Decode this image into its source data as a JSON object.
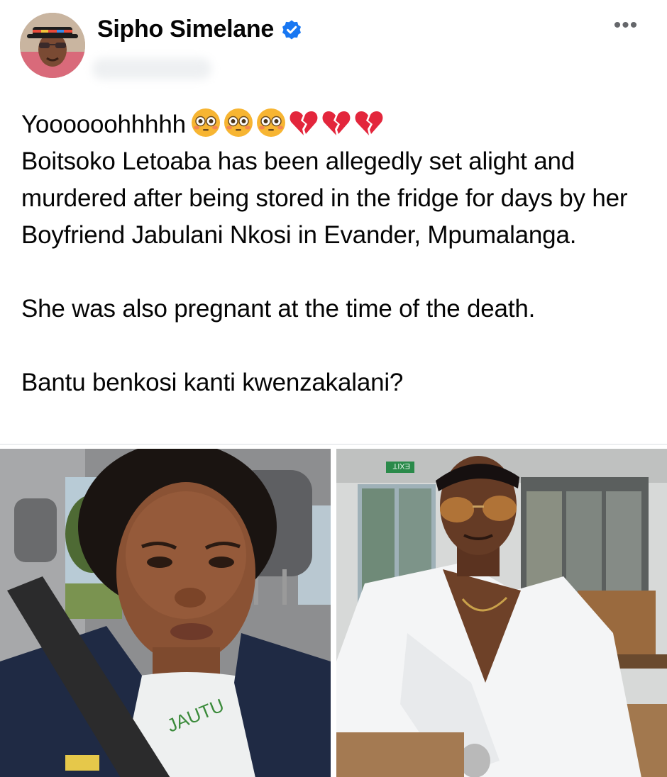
{
  "post": {
    "author": {
      "name": "Sipho Simelane",
      "verified": true,
      "avatar_icon": "profile-photo",
      "verified_icon": "verified-badge-icon"
    },
    "more_icon": "more-horizontal-icon",
    "more_label": "•••",
    "text": {
      "line1": "Yoooooohhhhh",
      "line1_emojis": [
        "flushed-face",
        "flushed-face",
        "flushed-face",
        "broken-heart",
        "broken-heart",
        "broken-heart"
      ],
      "paragraph1": "Boitsoko Letoaba has been allegedly set alight and murdered after being stored in the fridge for days by her Boyfriend Jabulani Nkosi in Evander, Mpumalanga.",
      "paragraph2": "She was also pregnant at the time of the death.",
      "paragraph3": "Bantu benkosi kanti kwenzakalani?"
    },
    "photos": [
      {
        "name": "woman-selfie-photo",
        "shirt_text": "JAUTU"
      },
      {
        "name": "man-photo",
        "sign_text": "EXIT"
      }
    ],
    "colors": {
      "verified_blue": "#1877f2",
      "text": "#050505",
      "muted": "#65676b",
      "broken_heart": "#e3263c",
      "emoji_face": "#f7b532"
    }
  }
}
